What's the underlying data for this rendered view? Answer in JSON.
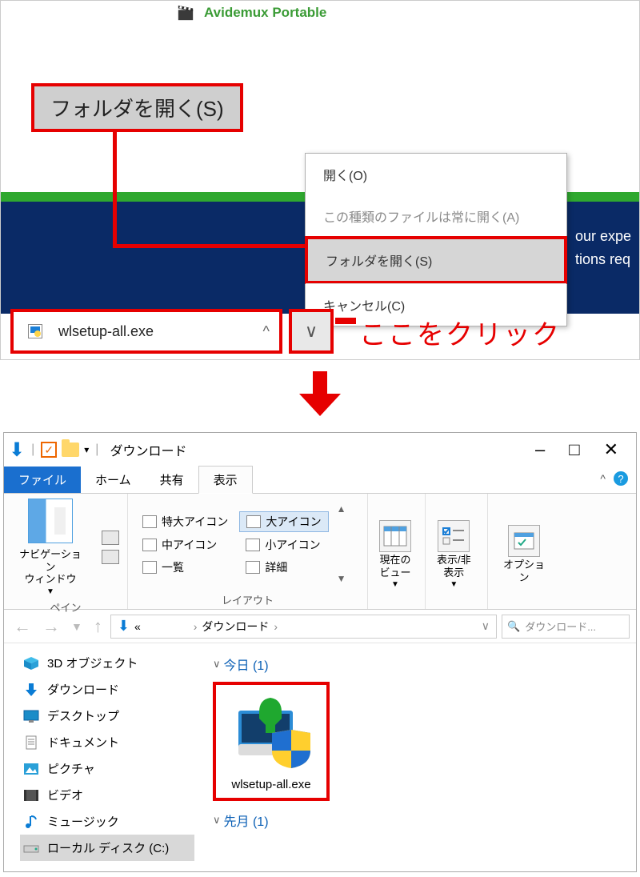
{
  "top": {
    "app_label": "Avidemux Portable",
    "callout": "フォルダを開く(S)",
    "context_menu": {
      "open": "開く(O)",
      "always_open": "この種類のファイルは常に開く(A)",
      "open_folder": "フォルダを開く(S)",
      "cancel": "キャンセル(C)"
    },
    "banner_lines": [
      "our expe",
      "tions req"
    ],
    "download_bar": {
      "filename": "wlsetup-all.exe"
    },
    "click_hint": "ここをクリック"
  },
  "explorer": {
    "title": "ダウンロード",
    "tabs": {
      "file": "ファイル",
      "home": "ホーム",
      "share": "共有",
      "view": "表示"
    },
    "ribbon": {
      "pane_group_label": "ペイン",
      "nav_plane": "ナビゲーション\nウィンドウ",
      "layout_group_label": "レイアウト",
      "layout": {
        "extra_large": "特大アイコン",
        "large": "大アイコン",
        "medium": "中アイコン",
        "small": "小アイコン",
        "list": "一覧",
        "details": "詳細"
      },
      "current_view": "現在の\nビュー",
      "show_hide": "表示/非\n表示",
      "options": "オプション"
    },
    "breadcrumbs": {
      "part1": "«",
      "part2": "ダウンロード",
      "sep": "›"
    },
    "search_placeholder": "ダウンロード...",
    "tree": {
      "objects3d": "3D オブジェクト",
      "downloads": "ダウンロード",
      "desktop": "デスクトップ",
      "documents": "ドキュメント",
      "pictures": "ピクチャ",
      "videos": "ビデオ",
      "music": "ミュージック",
      "localdisk": "ローカル ディスク (C:)"
    },
    "groups": {
      "today": "今日 (1)",
      "last_month": "先月 (1)"
    },
    "file_tile": "wlsetup-all.exe"
  }
}
